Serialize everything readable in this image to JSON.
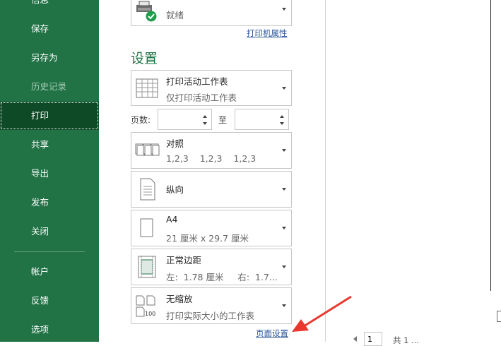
{
  "sidebar": {
    "items": [
      {
        "label": "信息"
      },
      {
        "label": "保存"
      },
      {
        "label": "另存为"
      },
      {
        "label": "历史记录"
      },
      {
        "label": "打印"
      },
      {
        "label": "共享"
      },
      {
        "label": "导出"
      },
      {
        "label": "发布"
      },
      {
        "label": "关闭"
      },
      {
        "label": "帐户"
      },
      {
        "label": "反馈"
      },
      {
        "label": "选项"
      }
    ]
  },
  "printer": {
    "status": "就绪",
    "properties_link": "打印机属性",
    "icon": "printer-ready-icon"
  },
  "settings": {
    "title": "设置",
    "scope": {
      "title": "打印活动工作表",
      "sub": "仅打印活动工作表",
      "icon": "worksheet-icon"
    },
    "pages": {
      "label": "页数:",
      "to": "至",
      "from_value": "",
      "to_value": ""
    },
    "collate": {
      "title": "对照",
      "sub": "1,2,3    1,2,3    1,2,3",
      "icon": "collate-icon"
    },
    "orientation": {
      "title": "纵向",
      "icon": "portrait-icon"
    },
    "paper": {
      "title": "A4",
      "sub": "21 厘米 x 29.7 厘米",
      "icon": "paper-icon"
    },
    "margins": {
      "title": "正常边距",
      "sub": "左:  1.78 厘米     右:  1.7...",
      "icon": "margins-icon"
    },
    "scaling": {
      "title": "无缩放",
      "sub": "打印实际大小的工作表",
      "icon": "no-scaling-icon"
    },
    "page_setup_link": "页面设置"
  },
  "preview": {
    "page_number": "1",
    "total_text": "共 1 ..."
  },
  "colors": {
    "sidebar_bg": "#217346",
    "active_item_bg": "#0f4a26",
    "accent_green": "#217346",
    "annotation_arrow": "#e8382f"
  }
}
